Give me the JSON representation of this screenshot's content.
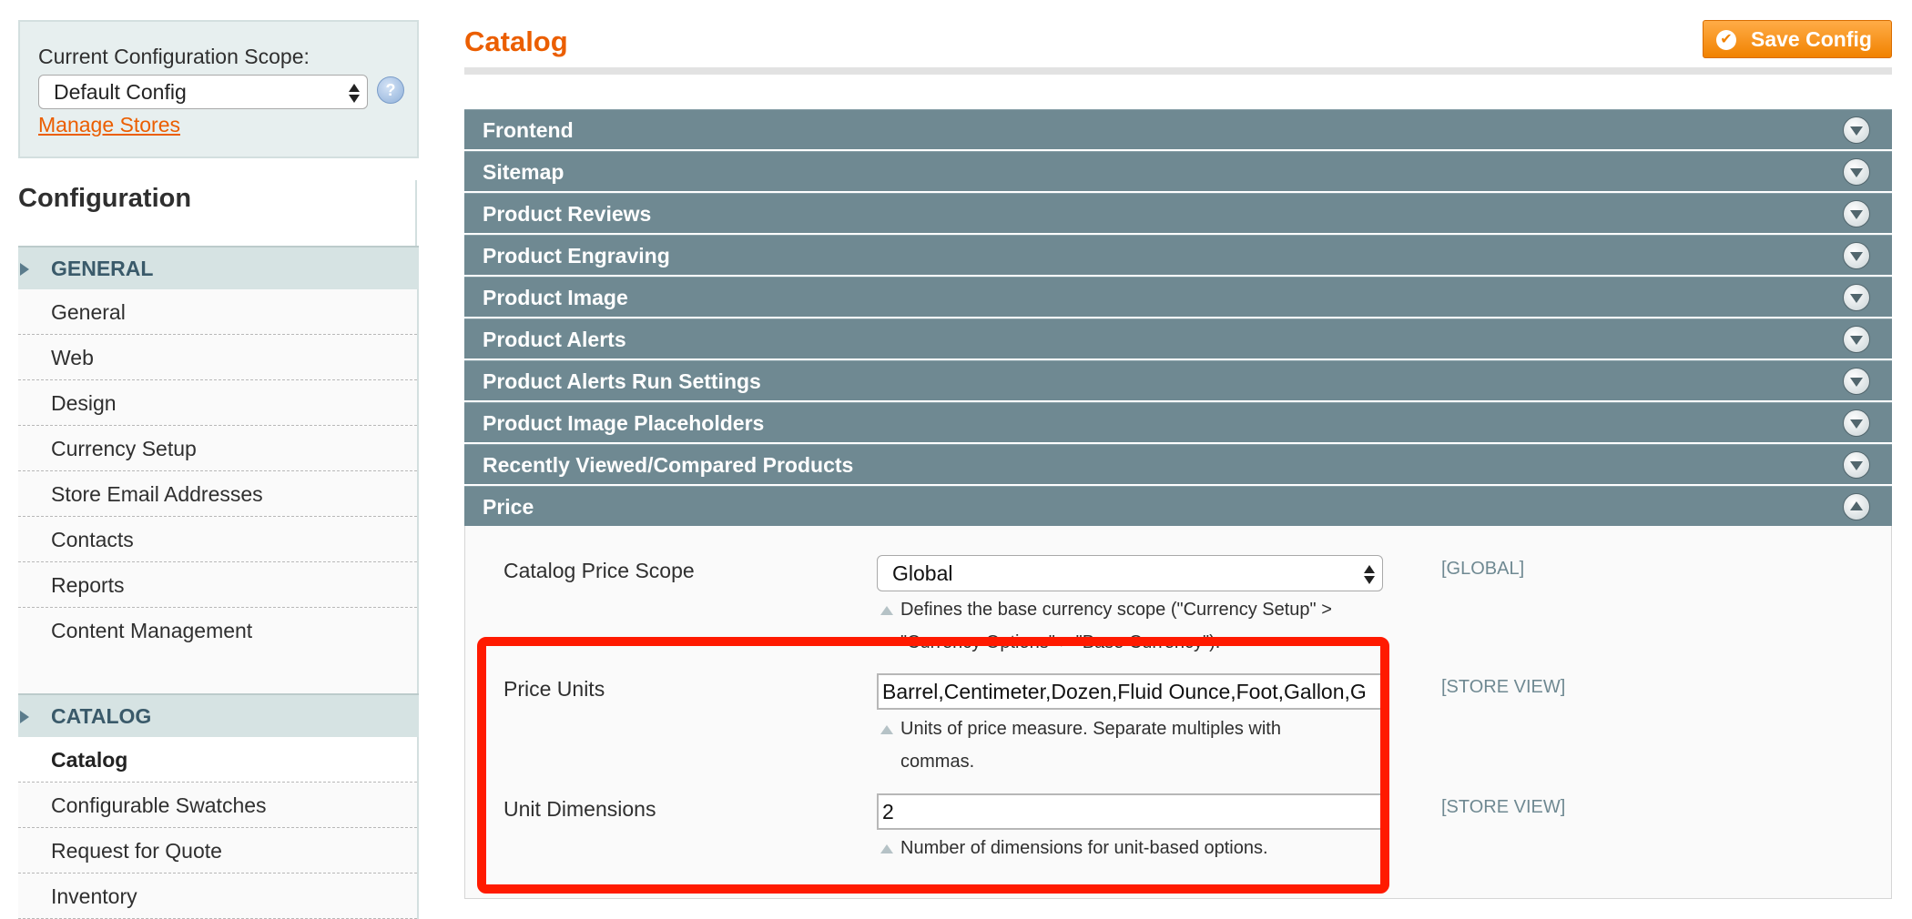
{
  "sidebar": {
    "scope_title": "Current Configuration Scope:",
    "scope_value": "Default Config",
    "help_label": "?",
    "manage_stores": "Manage Stores",
    "config_title": "Configuration",
    "sections": [
      {
        "title": "GENERAL",
        "items": [
          "General",
          "Web",
          "Design",
          "Currency Setup",
          "Store Email Addresses",
          "Contacts",
          "Reports",
          "Content Management"
        ]
      },
      {
        "title": "CATALOG",
        "items": [
          "Catalog",
          "Configurable Swatches",
          "Request for Quote",
          "Inventory"
        ]
      }
    ]
  },
  "main": {
    "title": "Catalog",
    "save_button": "Save Config",
    "sections": [
      "Frontend",
      "Sitemap",
      "Product Reviews",
      "Product Engraving",
      "Product Image",
      "Product Alerts",
      "Product Alerts Run Settings",
      "Product Image Placeholders",
      "Recently Viewed/Compared Products"
    ],
    "open_section": "Price",
    "fields": {
      "price_scope": {
        "label": "Catalog Price Scope",
        "value": "Global",
        "scope": "[GLOBAL]",
        "note_line1": "Defines the base currency scope (\"Currency Setup\" >",
        "note_line2": "\"Currency Options\" > \"Base Currency\")."
      },
      "price_units": {
        "label": "Price Units",
        "value": "Barrel,Centimeter,Dozen,Fluid Ounce,Foot,Gallon,G",
        "scope": "[STORE VIEW]",
        "note_line1": "Units of price measure. Separate multiples with",
        "note_line2": "commas."
      },
      "unit_dimensions": {
        "label": "Unit Dimensions",
        "value": "2",
        "scope": "[STORE VIEW]",
        "note": "Number of dimensions for unit-based options."
      }
    }
  },
  "colors": {
    "accent": "#eb5e00",
    "section_bar": "#6f8992",
    "highlight": "#ff1a00"
  }
}
